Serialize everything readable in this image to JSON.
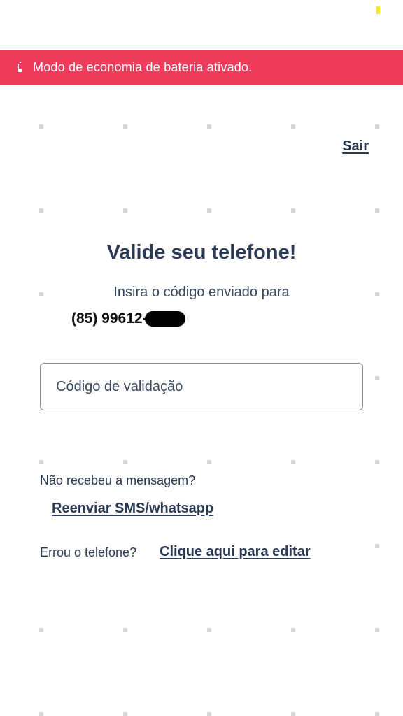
{
  "banner": {
    "text": "Modo de economia de bateria ativado.",
    "icon": "battery-icon",
    "background": "#ef3b5c"
  },
  "header": {
    "logout_label": "Sair"
  },
  "main": {
    "title": "Valide seu telefone!",
    "subtitle": "Insira o código enviado para",
    "phone_partial": "(85) 99612-",
    "code_input": {
      "placeholder": "Código de validação",
      "value": ""
    },
    "no_message_text": "Não recebeu a mensagem?",
    "resend_label": "Reenviar SMS/whatsapp",
    "wrong_phone_text": "Errou o telefone?",
    "edit_label": "Clique aqui para editar"
  },
  "colors": {
    "primary_text": "#2b3a55",
    "accent_banner": "#ef3b5c"
  }
}
